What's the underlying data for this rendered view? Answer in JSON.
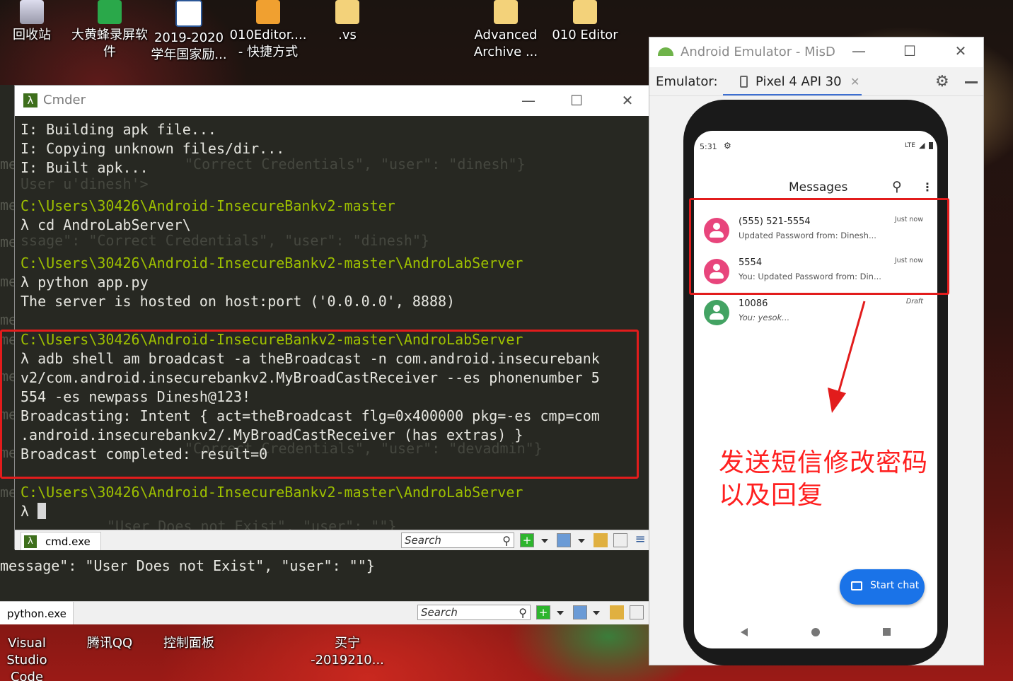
{
  "desktop": {
    "icons": [
      {
        "label": "回收站",
        "icon": "recycle-bin-icon"
      },
      {
        "label": "大黄蜂录屏软件",
        "icon": "screen-recorder-icon"
      },
      {
        "label": "2019-2020 学年国家励...",
        "icon": "word-doc-icon"
      },
      {
        "label": "010Editor.... - 快捷方式",
        "icon": "shortcut-icon"
      },
      {
        "label": ".vs",
        "icon": "folder-icon"
      },
      {
        "label": "Advanced Archive ...",
        "icon": "archive-icon"
      },
      {
        "label": "010 Editor",
        "icon": "folder-icon"
      },
      {
        "label": "Visual Studio Code",
        "icon": "vscode-icon"
      },
      {
        "label": "腾讯QQ",
        "icon": "qq-icon"
      },
      {
        "label": "控制面板",
        "icon": "control-panel-icon"
      },
      {
        "label": "买宁 -2019210...",
        "icon": "word-doc-icon"
      }
    ]
  },
  "python_console": {
    "lines": [
      "me",
      "me",
      "me",
      "me",
      "me",
      "me",
      "me",
      "me",
      "me",
      "me",
      "message\": \"User Does not Exist\", \"user\": \"\"}"
    ],
    "tab_label": "python.exe",
    "search_placeholder": "Search"
  },
  "cmder": {
    "title": "Cmder",
    "lines": [
      "I: Building apk file...",
      "I: Copying unknown files/dir...",
      "I: Built apk...",
      "",
      "C:\\Users\\30426\\Android-InsecureBankv2-master",
      "λ cd AndroLabServer\\",
      "",
      "C:\\Users\\30426\\Android-InsecureBankv2-master\\AndroLabServer",
      "λ python app.py",
      "The server is hosted on host:port ('0.0.0.0', 8888)",
      "",
      "C:\\Users\\30426\\Android-InsecureBankv2-master\\AndroLabServer",
      "λ adb shell am broadcast -a theBroadcast -n com.android.insecurebank",
      "v2/com.android.insecurebankv2.MyBroadCastReceiver --es phonenumber 5",
      "554 -es newpass Dinesh@123!",
      "Broadcasting: Intent { act=theBroadcast flg=0x400000 pkg=-es cmp=com",
      ".android.insecurebankv2/.MyBroadCastReceiver (has extras) }",
      "Broadcast completed: result=0",
      "",
      "C:\\Users\\30426\\Android-InsecureBankv2-master\\AndroLabServer",
      "λ "
    ],
    "ghost_text": [
      "\"Correct Credentials\", \"user\": \"dinesh\"}",
      "User u'dinesh'>",
      "ssage\": \"Correct Credentials\", \"user\": \"dinesh\"}",
      "\"Correct Credentials\", \"user\": \"devadmin\"}",
      "\"User Does not Exist\", \"user\": \"\"}"
    ],
    "tab_label": "cmd.exe",
    "search_placeholder": "Search"
  },
  "emulator": {
    "title": "Android Emulator - MisD",
    "toolbar_label": "Emulator:",
    "device_tab": "Pixel 4 API 30",
    "status_time": "5:31",
    "status_network": "LTE",
    "app_title": "Messages",
    "conversations": [
      {
        "name": "(555) 521-5554",
        "preview": "Updated Password from: Dinesh...",
        "time": "Just now",
        "avatar_color": "#e8457c"
      },
      {
        "name": "5554",
        "preview": "You: Updated Password from: Din...",
        "time": "Just now",
        "avatar_color": "#e8457c"
      },
      {
        "name": "10086",
        "preview": "You: yesok...",
        "time": "Draft",
        "avatar_color": "#43a363"
      }
    ],
    "fab_label": "Start chat"
  },
  "annotation": {
    "text": "发送短信修改密码\n以及回复",
    "color": "#ff2020"
  },
  "colors": {
    "terminal_bg": "#272822",
    "path_green": "#9ec000",
    "highlight_red": "#e21c1c",
    "fab_blue": "#1a73e8"
  }
}
